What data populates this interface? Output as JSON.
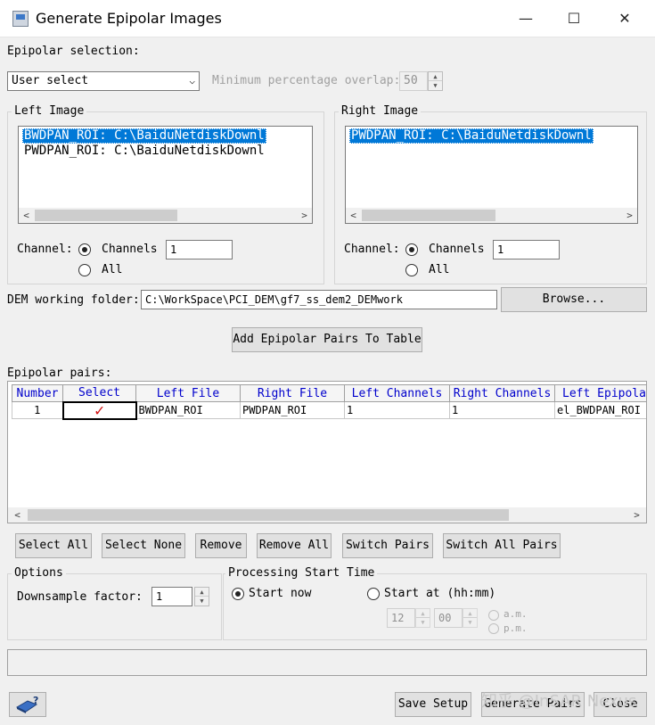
{
  "window": {
    "title": "Generate Epipolar Images",
    "minimize": "—",
    "maximize": "☐",
    "close": "✕"
  },
  "epipolar_selection": {
    "label": "Epipolar selection:",
    "mode": "User select",
    "overlap_label": "Minimum percentage overlap:",
    "overlap_value": "50"
  },
  "left_image": {
    "title": "Left Image",
    "items": [
      "BWDPAN_ROI: C:\\BaiduNetdiskDownl",
      "PWDPAN_ROI: C:\\BaiduNetdiskDownl"
    ],
    "channel_label": "Channel:",
    "channels_option": "Channels",
    "channels_value": "1",
    "all_option": "All"
  },
  "right_image": {
    "title": "Right Image",
    "items": [
      "PWDPAN_ROI: C:\\BaiduNetdiskDownl"
    ],
    "channel_label": "Channel:",
    "channels_option": "Channels",
    "channels_value": "1",
    "all_option": "All"
  },
  "dem": {
    "label": "DEM working folder:",
    "value": "C:\\WorkSpace\\PCI_DEM\\gf7_ss_dem2_DEMwork",
    "browse": "Browse..."
  },
  "add_pairs_button": "Add Epipolar Pairs To Table",
  "pairs": {
    "label": "Epipolar pairs:",
    "columns": [
      "Number",
      "Select",
      "Left File",
      "Right File",
      "Left Channels",
      "Right Channels",
      "Left Epipola"
    ],
    "rows": [
      {
        "number": "1",
        "select": "✓",
        "left_file": "BWDPAN_ROI",
        "right_file": "PWDPAN_ROI",
        "left_channels": "1",
        "right_channels": "1",
        "left_epipolar": "el_BWDPAN_ROI"
      }
    ]
  },
  "pair_buttons": [
    "Select All",
    "Select None",
    "Remove",
    "Remove All",
    "Switch Pairs",
    "Switch All Pairs"
  ],
  "options": {
    "title": "Options",
    "downsample_label": "Downsample factor:",
    "downsample_value": "1"
  },
  "processing": {
    "title": "Processing Start Time",
    "start_now": "Start now",
    "start_at": "Start at (hh:mm)",
    "hour": "12",
    "minute": "00",
    "am": "a.m.",
    "pm": "p.m."
  },
  "bottom": {
    "save_setup": "Save Setup",
    "generate_pairs": "Generate Pairs",
    "close": "Close"
  },
  "watermark": "知乎 @InSAR Nexus"
}
